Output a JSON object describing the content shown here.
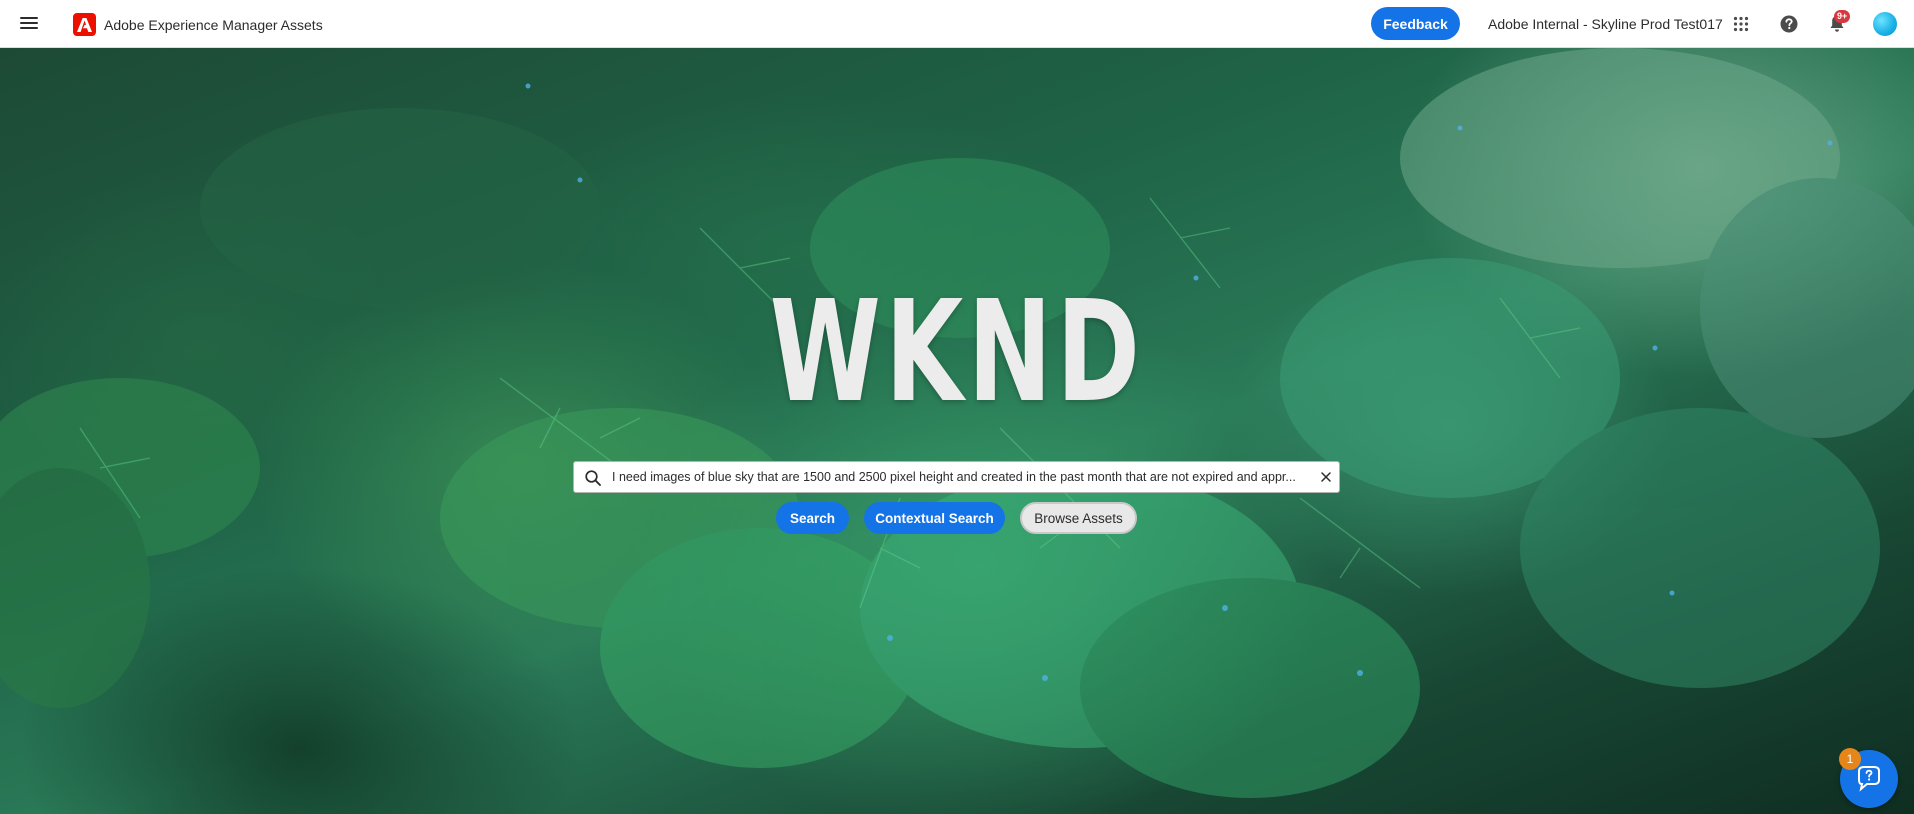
{
  "app": {
    "title": "Adobe Experience Manager Assets",
    "logo_icon": "adobe-logo-icon"
  },
  "header": {
    "feedback_label": "Feedback",
    "org_name": "Adobe Internal - Skyline Prod Test017",
    "notification_count": "9+",
    "icons": [
      "menu-icon",
      "apps-grid-icon",
      "help-icon",
      "bell-icon",
      "avatar"
    ]
  },
  "hero": {
    "brand_text": "WKND",
    "search": {
      "value": "I need images of blue sky that are 1500 and 2500 pixel height and created in the past month that are not expired and appr...",
      "placeholder": ""
    },
    "buttons": {
      "search": "Search",
      "contextual_search": "Contextual Search",
      "browse_assets": "Browse Assets"
    }
  },
  "help_widget": {
    "badge_count": "1"
  },
  "colors": {
    "accent": "#1473e6",
    "adobe_red": "#eb1000",
    "badge_red": "#d7373f",
    "badge_orange": "#e68619"
  }
}
